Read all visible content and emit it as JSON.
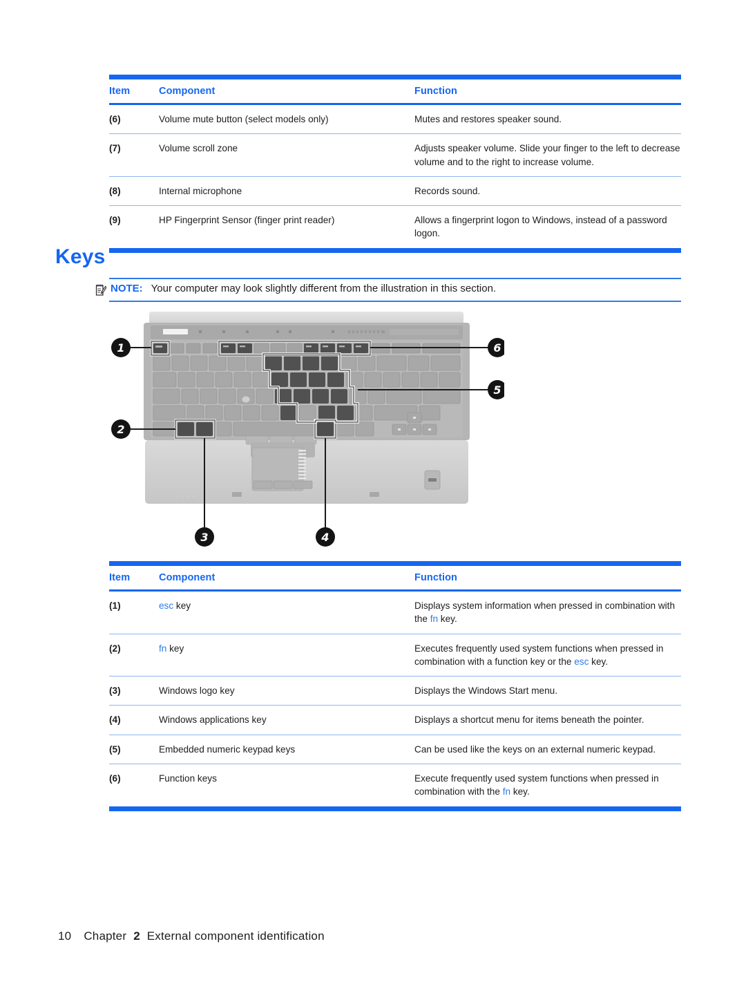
{
  "page": {
    "footer_page_number": "10",
    "footer_chapter_word": "Chapter",
    "footer_chapter_number": "2",
    "footer_chapter_title": "External component identification",
    "accent_blue": "#1566F0",
    "link_blue": "#2E7BE8"
  },
  "top_table": {
    "headers": {
      "item": "Item",
      "component": "Component",
      "function": "Function"
    },
    "rows": [
      {
        "item": "(6)",
        "component": "Volume mute button (select models only)",
        "function": "Mutes and restores speaker sound."
      },
      {
        "item": "(7)",
        "component": "Volume scroll zone",
        "function": "Adjusts speaker volume. Slide your finger to the left to decrease volume and to the right to increase volume."
      },
      {
        "item": "(8)",
        "component": "Internal microphone",
        "function": "Records sound."
      },
      {
        "item": "(9)",
        "component": "HP Fingerprint Sensor (finger print reader)",
        "function": "Allows a fingerprint logon to Windows, instead of a password logon."
      }
    ]
  },
  "section": {
    "title": "Keys",
    "note_label": "NOTE:",
    "note_text": "Your computer may look slightly different from the illustration in this section.",
    "note_icon": "note-pencil-icon"
  },
  "figure": {
    "name": "laptop-keyboard-illustration",
    "callouts": [
      "1",
      "2",
      "3",
      "4",
      "5",
      "6"
    ]
  },
  "bottom_table": {
    "headers": {
      "item": "Item",
      "component": "Component",
      "function": "Function"
    },
    "rows": [
      {
        "item": "(1)",
        "component_pre": "",
        "component_key": "esc",
        "component_post": " key",
        "component": "esc key",
        "function_parts": [
          {
            "t": "Displays system information when pressed in combination with the ",
            "k": false
          },
          {
            "t": "fn",
            "k": true
          },
          {
            "t": " key.",
            "k": false
          }
        ],
        "function": "Displays system information when pressed in combination with the fn key."
      },
      {
        "item": "(2)",
        "component_pre": "",
        "component_key": "fn",
        "component_post": " key",
        "component": "fn key",
        "function_parts": [
          {
            "t": "Executes frequently used system functions when pressed in combination with a function key or the ",
            "k": false
          },
          {
            "t": "esc",
            "k": true
          },
          {
            "t": " key.",
            "k": false
          }
        ],
        "function": "Executes frequently used system functions when pressed in combination with a function key or the esc key."
      },
      {
        "item": "(3)",
        "component_pre": "Windows logo key",
        "component_key": "",
        "component_post": "",
        "component": "Windows logo key",
        "function_parts": [
          {
            "t": "Displays the Windows Start menu.",
            "k": false
          }
        ],
        "function": "Displays the Windows Start menu."
      },
      {
        "item": "(4)",
        "component_pre": "Windows applications key",
        "component_key": "",
        "component_post": "",
        "component": "Windows applications key",
        "function_parts": [
          {
            "t": "Displays a shortcut menu for items beneath the pointer.",
            "k": false
          }
        ],
        "function": "Displays a shortcut menu for items beneath the pointer."
      },
      {
        "item": "(5)",
        "component_pre": "Embedded numeric keypad keys",
        "component_key": "",
        "component_post": "",
        "component": "Embedded numeric keypad keys",
        "function_parts": [
          {
            "t": "Can be used like the keys on an external numeric keypad.",
            "k": false
          }
        ],
        "function": "Can be used like the keys on an external numeric keypad."
      },
      {
        "item": "(6)",
        "component_pre": "Function keys",
        "component_key": "",
        "component_post": "",
        "component": "Function keys",
        "function_parts": [
          {
            "t": "Execute frequently used system functions when pressed in combination with the ",
            "k": false
          },
          {
            "t": "fn",
            "k": true
          },
          {
            "t": " key.",
            "k": false
          }
        ],
        "function": "Execute frequently used system functions when pressed in combination with the fn key."
      }
    ]
  }
}
